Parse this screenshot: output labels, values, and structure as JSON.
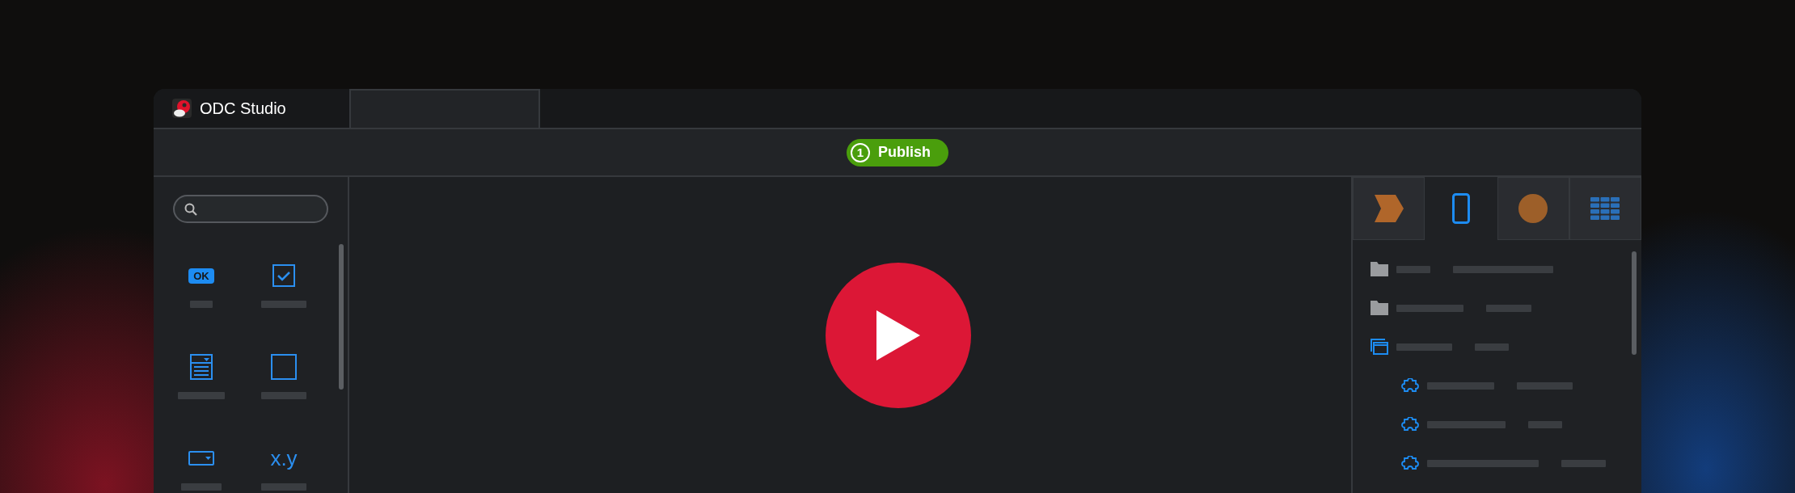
{
  "window": {
    "app_tab": {
      "title": "ODC Studio"
    },
    "second_tab": {
      "selected": false
    }
  },
  "toolbar": {
    "publish": {
      "count": "1",
      "label": "Publish"
    }
  },
  "left_panel": {
    "widgets": [
      {
        "kind": "button",
        "text": "OK"
      },
      {
        "kind": "checkbox"
      },
      {
        "kind": "list"
      },
      {
        "kind": "container"
      },
      {
        "kind": "dropdown"
      },
      {
        "kind": "expression",
        "text": "x.y"
      }
    ]
  },
  "canvas": {
    "kind": "video"
  },
  "right_panel": {
    "tabs": [
      {
        "kind": "chevron",
        "selected": false
      },
      {
        "kind": "phone",
        "selected": true
      },
      {
        "kind": "circle",
        "selected": false
      },
      {
        "kind": "grid",
        "selected": false
      }
    ],
    "tree": [
      {
        "kind": "folder"
      },
      {
        "kind": "folder"
      },
      {
        "kind": "screens",
        "children": [
          {
            "kind": "block"
          },
          {
            "kind": "block"
          },
          {
            "kind": "block"
          }
        ]
      }
    ]
  }
}
